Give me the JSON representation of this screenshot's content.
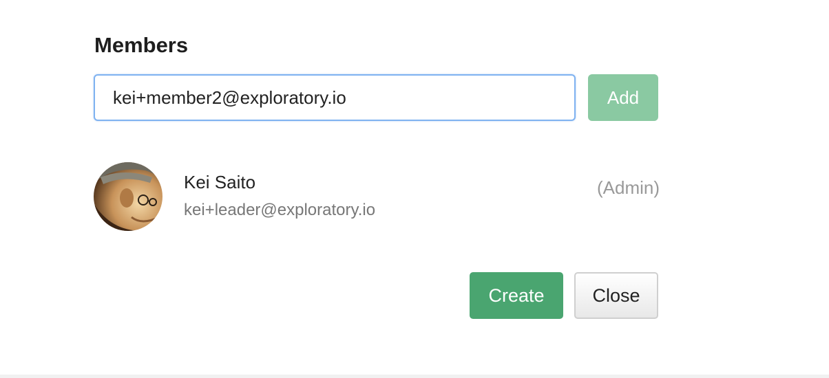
{
  "members": {
    "title": "Members",
    "email_input_value": "kei+member2@exploratory.io",
    "add_label": "Add",
    "list": [
      {
        "name": "Kei Saito",
        "email": "kei+leader@exploratory.io",
        "role": "(Admin)"
      }
    ]
  },
  "actions": {
    "create_label": "Create",
    "close_label": "Close"
  },
  "colors": {
    "add_button": "#8ac9a2",
    "create_button": "#4aa570",
    "input_focus_border": "#7fb2f0"
  }
}
